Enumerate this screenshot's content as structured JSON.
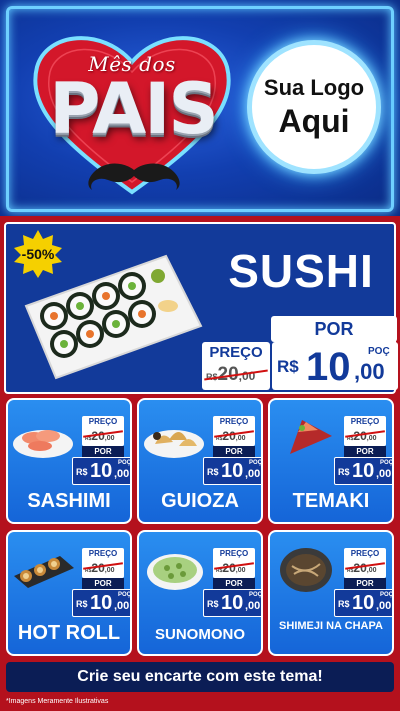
{
  "header": {
    "script_title": "Mês dos",
    "main_title": "PAIS",
    "logo_line1": "Sua Logo",
    "logo_line2": "Aqui"
  },
  "featured": {
    "discount_badge": "-50%",
    "name": "SUSHI",
    "preco_label": "PREÇO",
    "old_price": {
      "currency": "R$",
      "integer": "20",
      "decimal": ",00"
    },
    "por_label": "POR",
    "new_price": {
      "currency": "R$",
      "integer": "10",
      "decimal": ",00",
      "unit": "POÇ"
    }
  },
  "card_labels": {
    "preco": "PREÇO",
    "por": "POR",
    "unit": "POÇ"
  },
  "products": [
    {
      "name": "SASHIMI",
      "old": {
        "currency": "R$",
        "integer": "20",
        "decimal": ",00"
      },
      "new": {
        "currency": "R$",
        "integer": "10",
        "decimal": ",00"
      }
    },
    {
      "name": "GUIOZA",
      "old": {
        "currency": "R$",
        "integer": "20",
        "decimal": ",00"
      },
      "new": {
        "currency": "R$",
        "integer": "10",
        "decimal": ",00"
      }
    },
    {
      "name": "TEMAKI",
      "old": {
        "currency": "R$",
        "integer": "20",
        "decimal": ",00"
      },
      "new": {
        "currency": "R$",
        "integer": "10",
        "decimal": ",00"
      }
    },
    {
      "name": "HOT ROLL",
      "old": {
        "currency": "R$",
        "integer": "20",
        "decimal": ",00"
      },
      "new": {
        "currency": "R$",
        "integer": "10",
        "decimal": ",00"
      }
    },
    {
      "name": "SUNOMONO",
      "old": {
        "currency": "R$",
        "integer": "20",
        "decimal": ",00"
      },
      "new": {
        "currency": "R$",
        "integer": "10",
        "decimal": ",00"
      }
    },
    {
      "name": "SHIMEJI NA CHAPA",
      "old": {
        "currency": "R$",
        "integer": "20",
        "decimal": ",00"
      },
      "new": {
        "currency": "R$",
        "integer": "10",
        "decimal": ",00"
      }
    }
  ],
  "footer": {
    "cta": "Crie seu encarte com este tema!",
    "disclaimer": "*Imagens Meramente Ilustrativas"
  },
  "colors": {
    "header_blue": "#123fb0",
    "background_red": "#b4111d",
    "card_blue": "#2a8ef0",
    "price_blue": "#123a9a",
    "neon_cyan": "#6fd0ff",
    "badge_yellow": "#f5d000"
  }
}
